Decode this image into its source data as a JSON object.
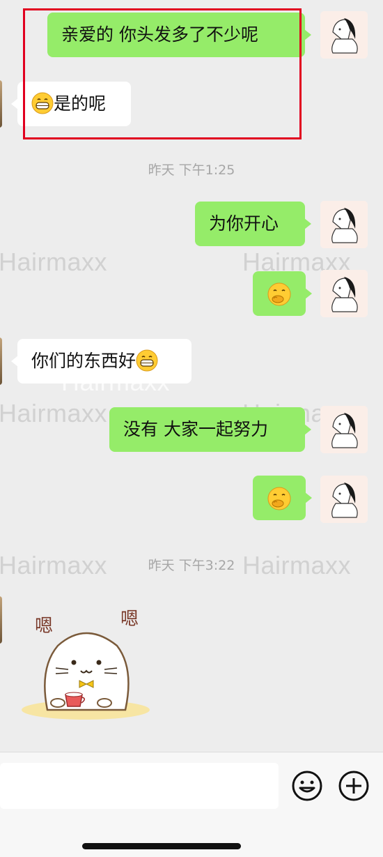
{
  "chat": {
    "messages": [
      {
        "side": "right",
        "text": "亲爱的 你头发多了不少呢"
      },
      {
        "side": "left",
        "text": "是的呢",
        "emoji": "grinning-emoji"
      },
      {
        "side": "right",
        "text": "为你开心"
      },
      {
        "side": "right",
        "emoji": "hand-over-mouth-emoji"
      },
      {
        "side": "left",
        "text": "你们的东西好",
        "emoji": "grinning-emoji"
      },
      {
        "side": "right",
        "text": "没有 大家一起努力"
      },
      {
        "side": "right",
        "emoji": "hand-over-mouth-emoji"
      },
      {
        "side": "left",
        "sticker": "seal-sticker"
      }
    ],
    "timestamps": [
      "昨天 下午1:25",
      "昨天 下午3:22"
    ],
    "sticker": {
      "left_text": "嗯",
      "right_text": "嗯"
    }
  },
  "watermark": {
    "text": "Hairmaxx"
  },
  "highlight_color": "#e1001f",
  "bubble_color_sent": "#95ec69",
  "bubble_color_received": "#ffffff",
  "input_bar": {
    "text_value": "",
    "emoji_button_icon": "smiley-icon",
    "plus_button_icon": "plus-circle-icon"
  }
}
